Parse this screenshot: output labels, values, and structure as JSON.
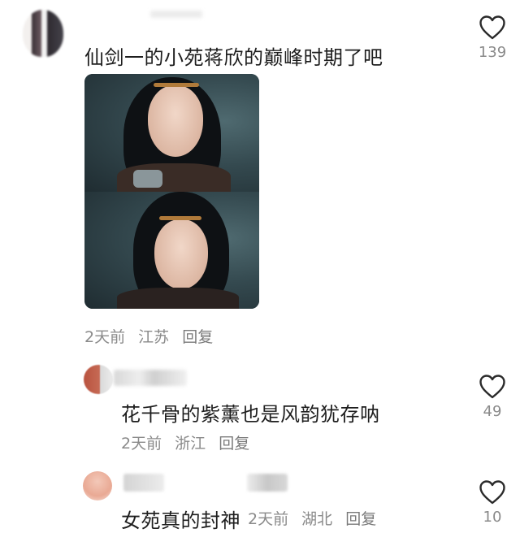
{
  "comments": [
    {
      "text": "仙剑一的小苑蒋欣的巅峰时期了吧",
      "time": "2天前",
      "location": "江苏",
      "reply_label": "回复",
      "likes": "139"
    }
  ],
  "replies": [
    {
      "text": "花千骨的紫薰也是风韵犹存呐",
      "time": "2天前",
      "location": "浙江",
      "reply_label": "回复",
      "likes": "49"
    },
    {
      "text": "女苑真的封神",
      "time": "2天前",
      "location": "湖北",
      "reply_label": "回复",
      "likes": "10"
    }
  ],
  "icons": {
    "like": "heart-outline-icon"
  },
  "colors": {
    "text": "#1e1e1e",
    "meta": "#8a8a8a"
  }
}
